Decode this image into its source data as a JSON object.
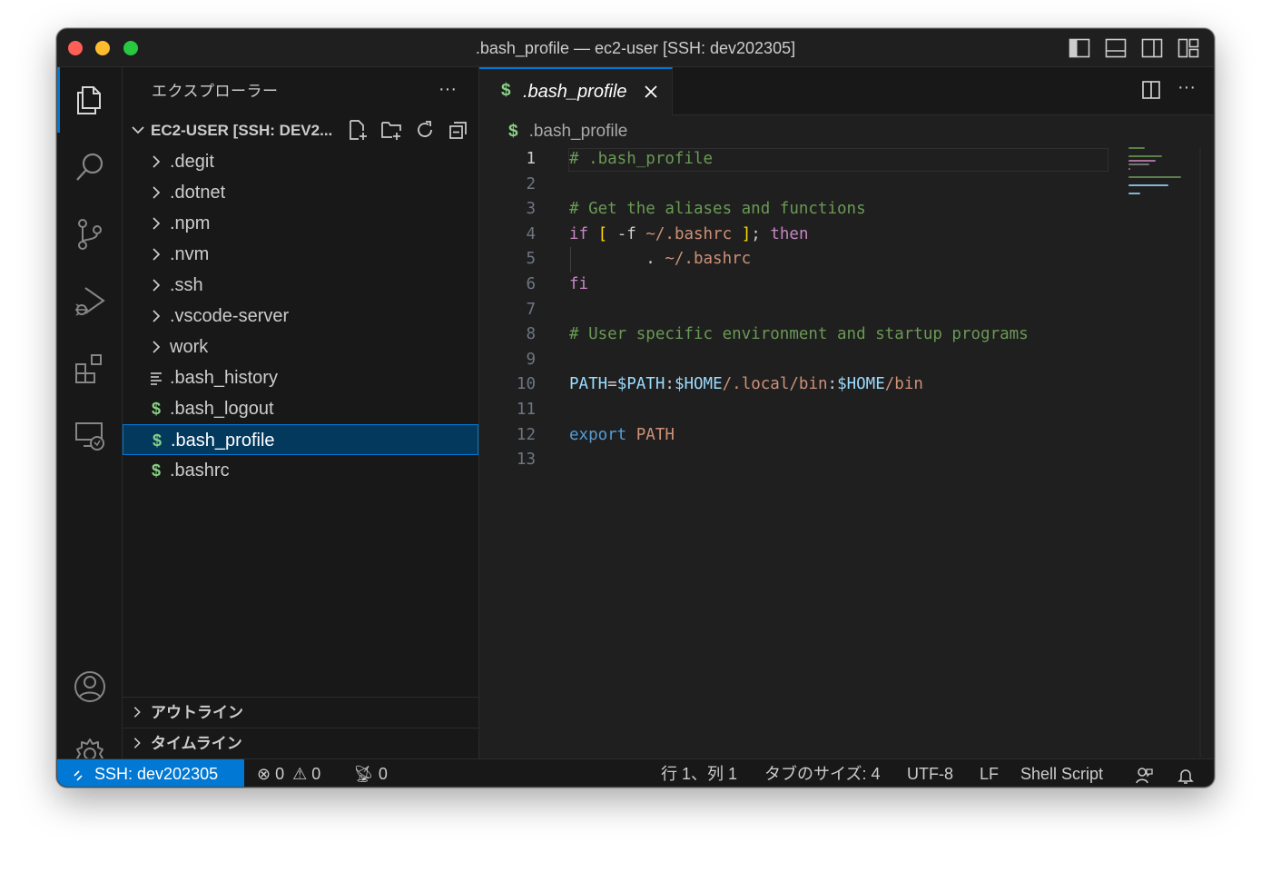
{
  "window": {
    "title": ".bash_profile — ec2-user [SSH: dev202305]"
  },
  "activity_bar": {
    "items": [
      "explorer-icon",
      "search-icon",
      "source-control-icon",
      "run-debug-icon",
      "extensions-icon",
      "remote-explorer-icon"
    ],
    "bottom_items": [
      "accounts-icon",
      "settings-gear-icon"
    ]
  },
  "sidebar": {
    "header": "エクスプローラー",
    "more": "···",
    "root": {
      "label": "EC2-USER [SSH: DEV2..."
    },
    "items": [
      {
        "label": ".degit",
        "type": "folder"
      },
      {
        "label": ".dotnet",
        "type": "folder"
      },
      {
        "label": ".npm",
        "type": "folder"
      },
      {
        "label": ".nvm",
        "type": "folder"
      },
      {
        "label": ".ssh",
        "type": "folder"
      },
      {
        "label": ".vscode-server",
        "type": "folder"
      },
      {
        "label": "work",
        "type": "folder"
      },
      {
        "label": ".bash_history",
        "type": "text"
      },
      {
        "label": ".bash_logout",
        "type": "shell"
      },
      {
        "label": ".bash_profile",
        "type": "shell",
        "selected": true
      },
      {
        "label": ".bashrc",
        "type": "shell"
      }
    ],
    "panels": [
      {
        "label": "アウトライン"
      },
      {
        "label": "タイムライン"
      }
    ]
  },
  "editor": {
    "tab": {
      "label": ".bash_profile",
      "icon": "$"
    },
    "more": "···",
    "breadcrumb": {
      "icon": "$",
      "label": ".bash_profile"
    },
    "lines": [
      {
        "n": "1",
        "t": "# .bash_profile"
      },
      {
        "n": "2",
        "t": ""
      },
      {
        "n": "3",
        "t": "# Get the aliases and functions"
      },
      {
        "n": "4",
        "t": "if [ -f ~/.bashrc ]; then"
      },
      {
        "n": "5",
        "t": "        . ~/.bashrc"
      },
      {
        "n": "6",
        "t": "fi"
      },
      {
        "n": "7",
        "t": ""
      },
      {
        "n": "8",
        "t": "# User specific environment and startup programs"
      },
      {
        "n": "9",
        "t": ""
      },
      {
        "n": "10",
        "t": "PATH=$PATH:$HOME/.local/bin:$HOME/bin"
      },
      {
        "n": "11",
        "t": ""
      },
      {
        "n": "12",
        "t": "export PATH"
      },
      {
        "n": "13",
        "t": ""
      }
    ]
  },
  "statusbar": {
    "remote": "SSH: dev202305",
    "errors": "0",
    "warnings": "0",
    "ports": "0",
    "position": "行 1、列 1",
    "tab_size": "タブのサイズ: 4",
    "encoding": "UTF-8",
    "eol": "LF",
    "language": "Shell Script"
  },
  "colors": {
    "accent": "#0078d4",
    "background": "#1f1f1f",
    "sidebar": "#181818",
    "shell_icon": "#89d185",
    "comment": "#6a9955",
    "keyword": "#c586c0",
    "variable": "#9cdcfe",
    "string": "#ce9178"
  }
}
